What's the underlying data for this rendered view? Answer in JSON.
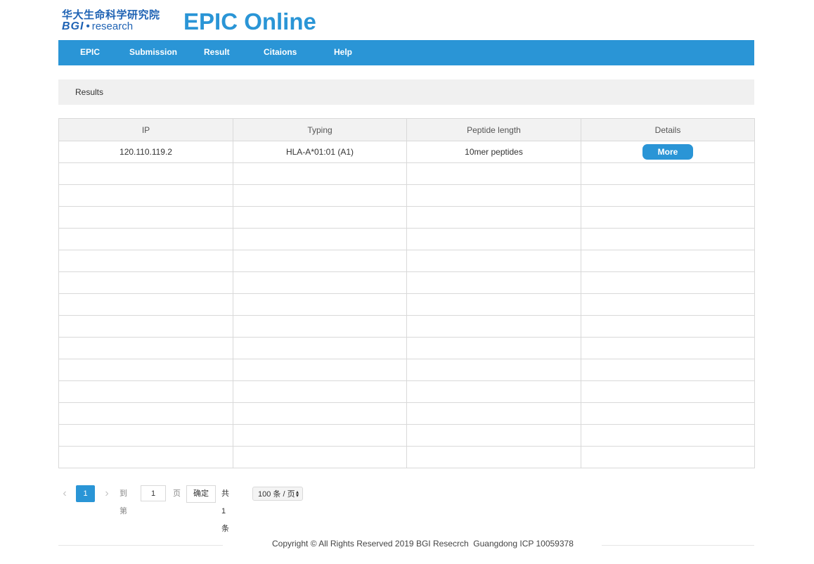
{
  "logo": {
    "cn": "华大生命科学研究院",
    "bgi": "BGI",
    "dot": "•",
    "research": "research"
  },
  "site_title": "EPIC Online",
  "nav": [
    "EPIC",
    "Submission",
    "Result",
    "Citaions",
    "Help"
  ],
  "breadcrumb": "Results",
  "table": {
    "headers": [
      "IP",
      "Typing",
      "Peptide length",
      "Details"
    ],
    "rows": [
      {
        "ip": "120.110.119.2",
        "typing": "HLA-A*01:01 (A1)",
        "peptide_length": "10mer peptides",
        "details_button": "More"
      }
    ]
  },
  "pager": {
    "current_page": "1",
    "goto_label": "到第",
    "goto_value": "1",
    "page_unit": "页",
    "confirm_label": "确定",
    "total_label": "共 1 条",
    "page_size": "100 条 / 页"
  },
  "footer": "Copyright © All Rights Reserved 2019 BGI Resecrch  Guangdong ICP 10059378",
  "colors": {
    "primary": "#2a95d6",
    "logo": "#1f63b4",
    "header_bg": "#f2f2f2",
    "breadcrumb_bg": "#f0f0f0"
  },
  "icons": [
    "chevron-left-icon",
    "chevron-right-icon",
    "select-caret-icon"
  ]
}
